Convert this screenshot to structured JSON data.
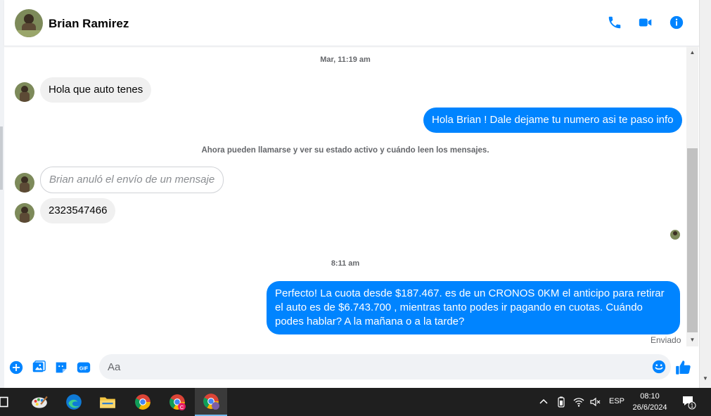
{
  "header": {
    "contact_name": "Brian Ramirez"
  },
  "conversation": {
    "timestamp_1": "Mar, 11:19 am",
    "msg_in_1": "Hola que auto tenes",
    "msg_out_1": "Hola Brian ! Dale dejame tu numero asi te paso info",
    "info_note": "Ahora pueden llamarse y ver su estado activo y cuándo leen los mensajes.",
    "msg_removed": "Brian anuló el envío de un mensaje",
    "msg_in_2": "2323547466",
    "timestamp_2": "8:11 am",
    "msg_out_2": "Perfecto! La cuota desde $187.467. es de un CRONOS 0KM el anticipo para retirar el auto es de $6.743.700 , mientras tanto podes ir pagando en cuotas. Cuándo podes hablar? A la mañana o a la tarde?",
    "delivery_status": "Enviado"
  },
  "composer": {
    "placeholder": "Aa"
  },
  "taskbar": {
    "language": "ESP",
    "time": "08:10",
    "date": "26/6/2024",
    "notification_count": "1"
  },
  "colors": {
    "accent": "#0084ff",
    "incoming_bubble": "#f0f0f0",
    "taskbar": "#1f1f1f"
  },
  "icons": {
    "header": [
      "phone-icon",
      "video-camera-icon",
      "info-icon"
    ],
    "composer": [
      "plus-icon",
      "image-icon",
      "sticker-icon",
      "gif-icon",
      "emoji-icon",
      "thumbs-up-icon"
    ]
  }
}
